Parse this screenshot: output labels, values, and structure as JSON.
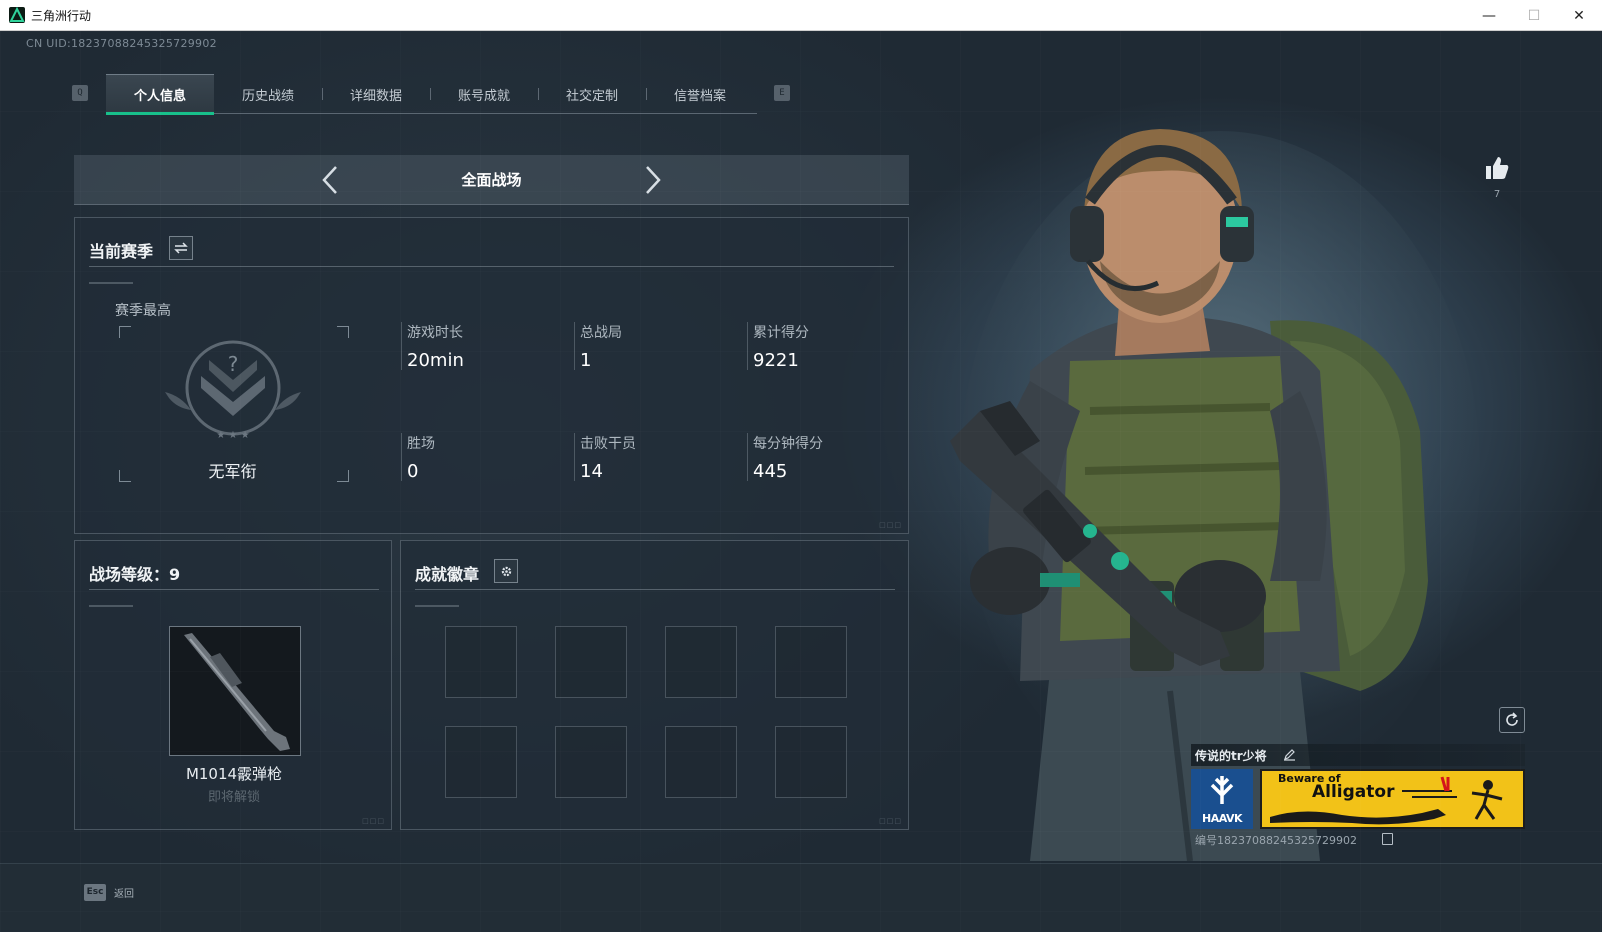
{
  "window": {
    "title": "三角洲行动",
    "minimize": "—",
    "maximize": "☐",
    "close": "✕"
  },
  "header": {
    "uid": "CN UID:18237088245325729902",
    "prev_tab_key": "Q",
    "next_tab_key": "E"
  },
  "tabs": [
    {
      "label": "个人信息",
      "active": true
    },
    {
      "label": "历史战绩",
      "active": false
    },
    {
      "label": "详细数据",
      "active": false
    },
    {
      "label": "账号成就",
      "active": false
    },
    {
      "label": "社交定制",
      "active": false
    },
    {
      "label": "信誉档案",
      "active": false
    }
  ],
  "mode": {
    "label": "全面战场"
  },
  "season": {
    "title": "当前赛季",
    "best_label": "赛季最高",
    "rank_name": "无军衔",
    "stats": [
      {
        "label": "游戏时长",
        "value": "20min"
      },
      {
        "label": "总战局",
        "value": "1"
      },
      {
        "label": "累计得分",
        "value": "9221"
      },
      {
        "label": "胜场",
        "value": "0"
      },
      {
        "label": "击败干员",
        "value": "14"
      },
      {
        "label": "每分钟得分",
        "value": "445"
      }
    ]
  },
  "level": {
    "title": "战场等级：9",
    "weapon_name": "M1014霰弹枪",
    "weapon_status": "即将解锁"
  },
  "badges": {
    "title": "成就徽章",
    "slots": 8
  },
  "profile": {
    "like_count": "7",
    "card_name": "传说的tr少将",
    "team_logo_text": "HAAVK",
    "banner_small": "Beware of",
    "banner_big": "Alligator",
    "serial": "编号18237088245325729902"
  },
  "footer": {
    "esc_key": "Esc",
    "back_label": "返回"
  },
  "colors": {
    "accent": "#18c08b",
    "banner_yellow": "#f2c218",
    "logo_blue": "#1a4f8f"
  }
}
